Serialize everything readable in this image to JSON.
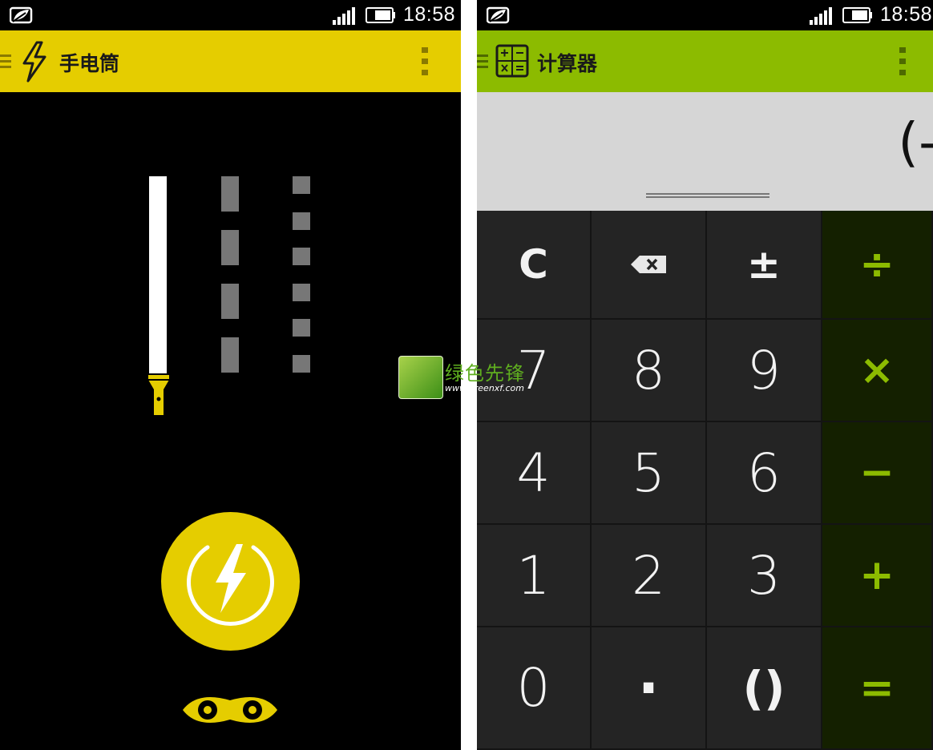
{
  "status_bar": {
    "time": "18:58"
  },
  "flashlight": {
    "title": "手电筒",
    "accent_color": "#e5cd00",
    "modes": [
      "steady",
      "slow-strobe",
      "fast-strobe"
    ],
    "icons": [
      "drawer-icon",
      "lightning-icon",
      "overflow-menu-icon",
      "flashlight-icon",
      "power-button-icon",
      "eyes-icon"
    ]
  },
  "calculator": {
    "title": "计算器",
    "accent_color": "#8cbb00",
    "display": "(-",
    "keys": [
      [
        "C",
        "⌫",
        "±",
        "÷"
      ],
      [
        "7",
        "8",
        "9",
        "×"
      ],
      [
        "4",
        "5",
        "6",
        "−"
      ],
      [
        "1",
        "2",
        "3",
        "+"
      ],
      [
        "0",
        "·",
        "()",
        "="
      ]
    ]
  },
  "watermark": {
    "name": "绿色先锋",
    "url": "www.greenxf.com"
  }
}
